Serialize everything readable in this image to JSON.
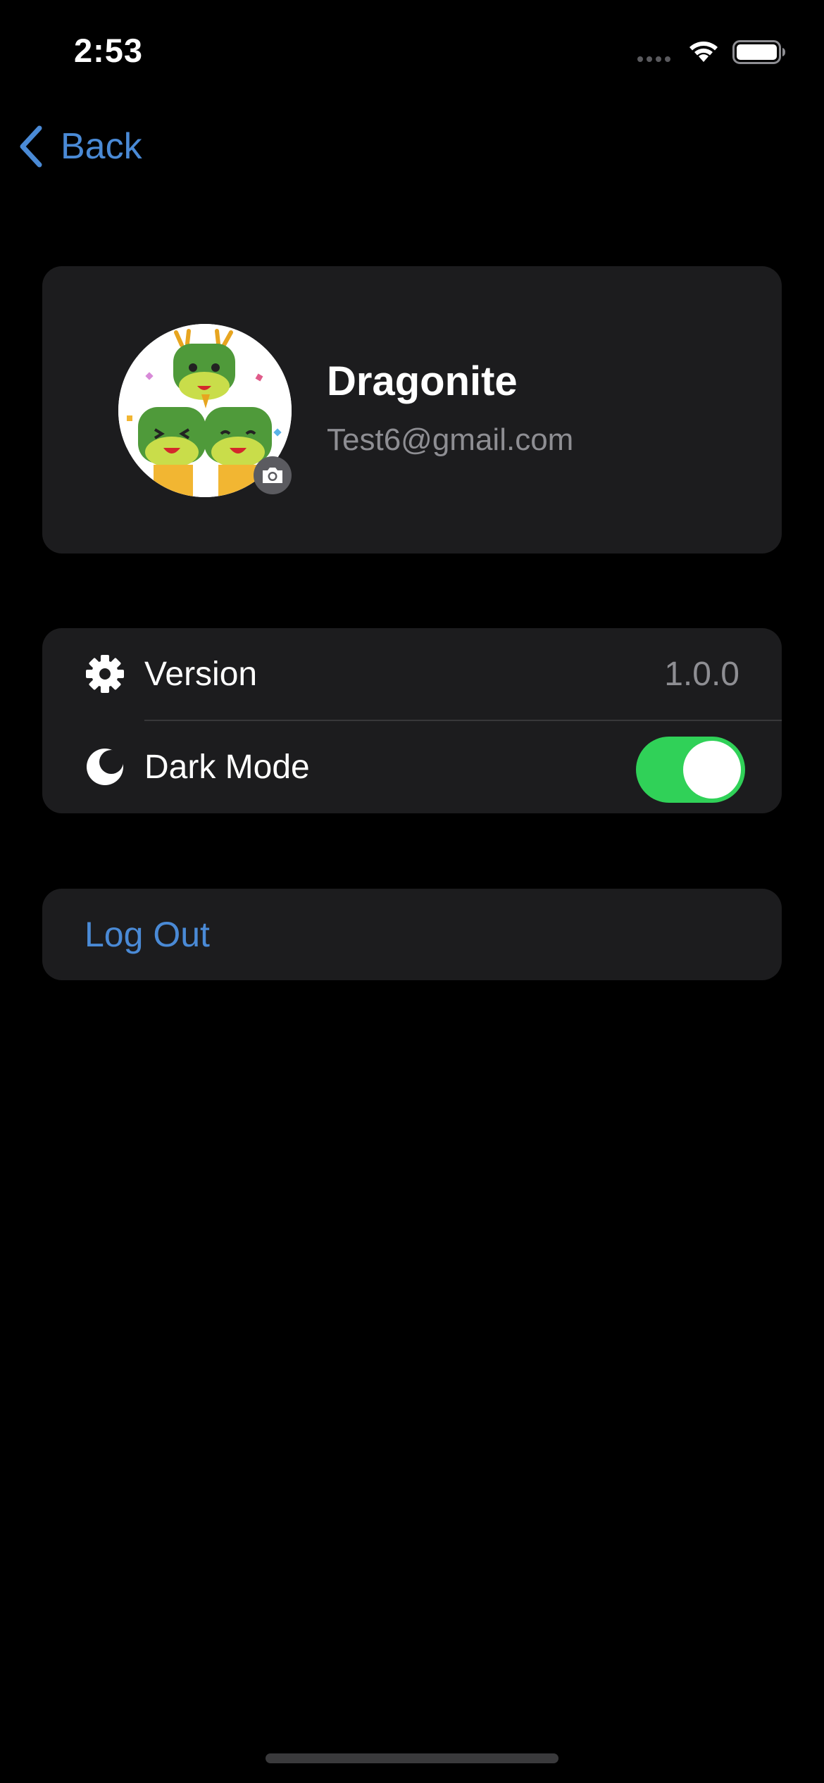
{
  "status_bar": {
    "time": "2:53",
    "wifi_icon": "wifi-icon",
    "battery_icon": "battery-icon",
    "battery_level": 1.0
  },
  "nav": {
    "back_label": "Back",
    "back_icon": "chevron-left-icon"
  },
  "profile": {
    "name": "Dragonite",
    "email": "Test6@gmail.com",
    "avatar_icon": "avatar-image",
    "camera_icon": "camera-icon"
  },
  "settings": {
    "version_label": "Version",
    "version_value": "1.0.0",
    "version_icon": "gear-icon",
    "dark_mode_label": "Dark Mode",
    "dark_mode_icon": "moon-icon",
    "dark_mode_on": true
  },
  "logout": {
    "label": "Log Out"
  },
  "colors": {
    "background": "#000000",
    "card": "#1c1c1e",
    "accent": "#4a8ad6",
    "toggle_on": "#30d158",
    "secondary_text": "#8e8e93"
  }
}
